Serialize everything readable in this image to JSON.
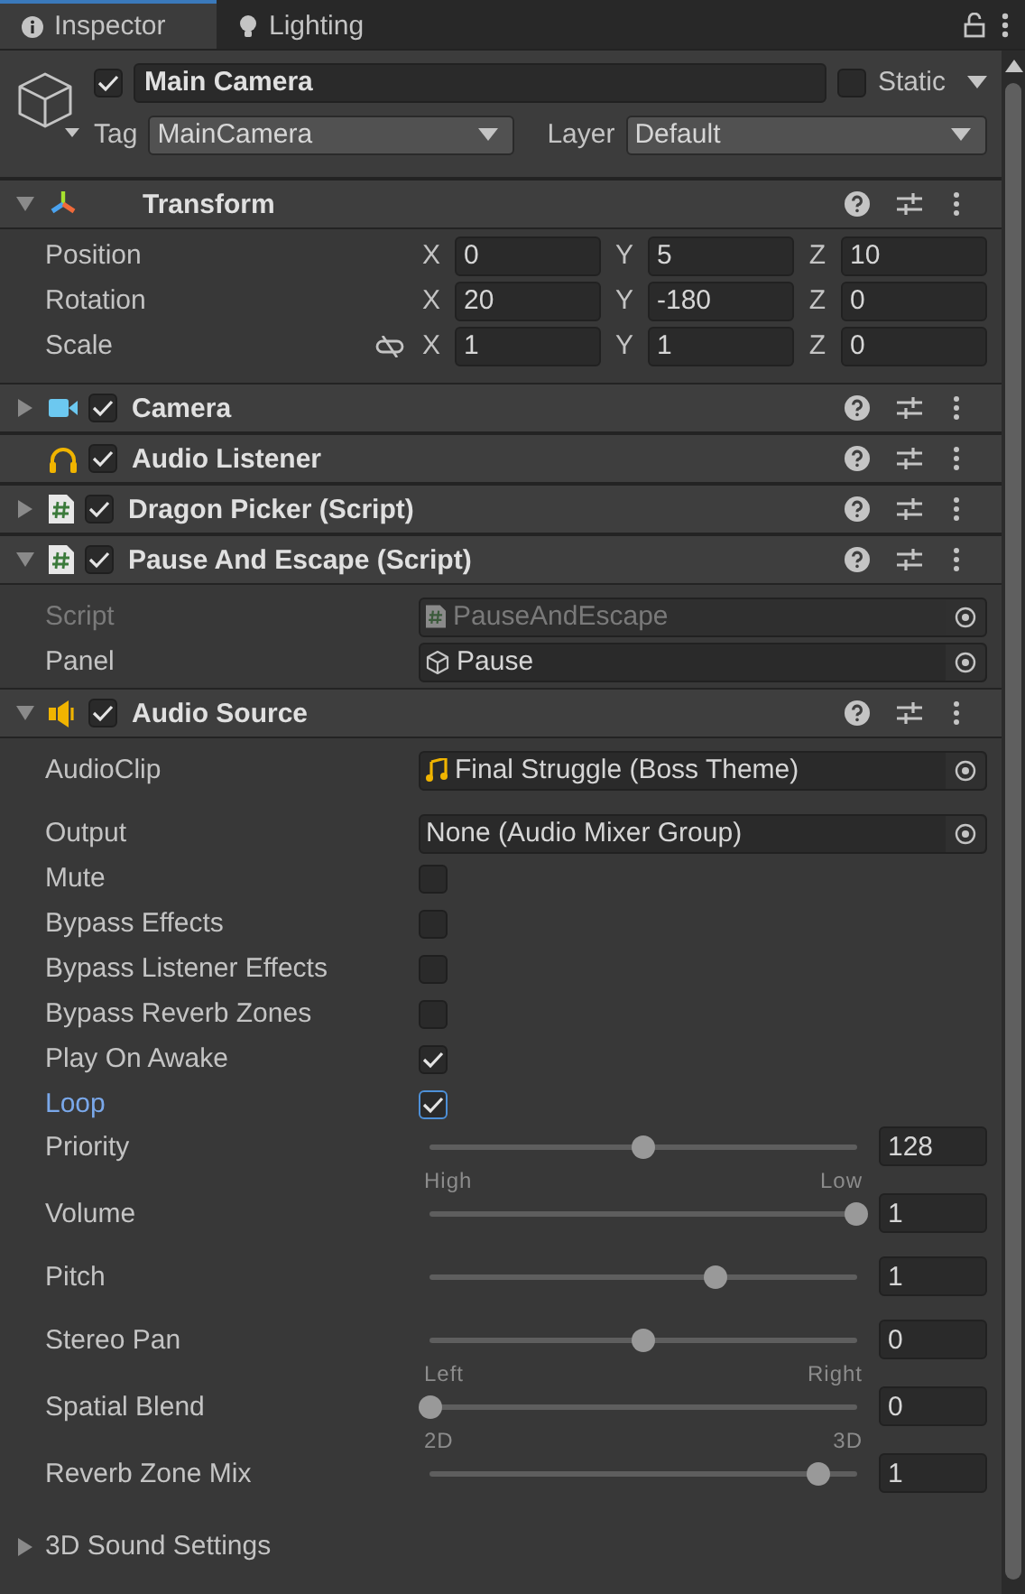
{
  "tabs": [
    {
      "label": "Inspector",
      "selected": true
    },
    {
      "label": "Lighting",
      "selected": false
    }
  ],
  "header": {
    "active": true,
    "name": "Main Camera",
    "static": false,
    "static_label": "Static",
    "tag_label": "Tag",
    "tag": "MainCamera",
    "layer_label": "Layer",
    "layer": "Default"
  },
  "transform": {
    "title": "Transform",
    "expanded": true,
    "rows": [
      {
        "label": "Position",
        "fields": [
          {
            "axis": "X",
            "value": "0"
          },
          {
            "axis": "Y",
            "value": "5"
          },
          {
            "axis": "Z",
            "value": "10"
          }
        ]
      },
      {
        "label": "Rotation",
        "fields": [
          {
            "axis": "X",
            "value": "20"
          },
          {
            "axis": "Y",
            "value": "-180"
          },
          {
            "axis": "Z",
            "value": "0"
          }
        ]
      },
      {
        "label": "Scale",
        "proportional": false,
        "fields": [
          {
            "axis": "X",
            "value": "1"
          },
          {
            "axis": "Y",
            "value": "1"
          },
          {
            "axis": "Z",
            "value": "0"
          }
        ]
      }
    ]
  },
  "components": [
    {
      "kind": "camera",
      "title": "Camera",
      "enabled": true,
      "expanded": false
    },
    {
      "kind": "listener",
      "title": "Audio Listener",
      "enabled": true
    },
    {
      "kind": "script",
      "title": "Dragon Picker (Script)",
      "enabled": true,
      "expanded": false
    },
    {
      "kind": "script",
      "title": "Pause And Escape (Script)",
      "enabled": true,
      "expanded": true,
      "properties": [
        {
          "kind": "script_ref",
          "label": "Script",
          "value": "PauseAndEscape",
          "disabled": true
        },
        {
          "kind": "gameobject_ref",
          "label": "Panel",
          "value": "Pause",
          "disabled": false
        }
      ]
    },
    {
      "kind": "audio",
      "title": "Audio Source",
      "enabled": true,
      "expanded": true,
      "properties": [
        {
          "kind": "clip_ref",
          "label": "AudioClip",
          "value": "Final Struggle (Boss Theme)",
          "disabled": false
        },
        {
          "kind": "object",
          "label": "Output",
          "value": "None (Audio Mixer Group)",
          "disabled": false
        },
        {
          "kind": "toggle",
          "label": "Mute",
          "checked": false,
          "focused": false
        },
        {
          "kind": "toggle",
          "label": "Bypass Effects",
          "checked": false,
          "focused": false
        },
        {
          "kind": "toggle",
          "label": "Bypass Listener Effects",
          "checked": false,
          "focused": false
        },
        {
          "kind": "toggle",
          "label": "Bypass Reverb Zones",
          "checked": false,
          "focused": false
        },
        {
          "kind": "toggle",
          "label": "Play On Awake",
          "checked": true,
          "focused": false
        },
        {
          "kind": "toggle",
          "label": "Loop",
          "checked": true,
          "focused": true
        },
        {
          "kind": "slider",
          "label": "Priority",
          "level": 0.5,
          "value": "128",
          "min_label": "High",
          "max_label": "Low"
        },
        {
          "kind": "slider",
          "label": "Volume",
          "level": 1,
          "value": "1"
        },
        {
          "kind": "slider",
          "label": "Pitch",
          "level": 0.67,
          "value": "1"
        },
        {
          "kind": "slider",
          "label": "Stereo Pan",
          "level": 0.5,
          "value": "0",
          "min_label": "Left",
          "max_label": "Right"
        },
        {
          "kind": "slider",
          "label": "Spatial Blend",
          "level": 0,
          "value": "0",
          "min_label": "2D",
          "max_label": "3D"
        },
        {
          "kind": "slider",
          "label": "Reverb Zone Mix",
          "level": 0.91,
          "value": "1"
        }
      ]
    }
  ],
  "footer": {
    "label": "3D Sound Settings",
    "expanded": false
  }
}
